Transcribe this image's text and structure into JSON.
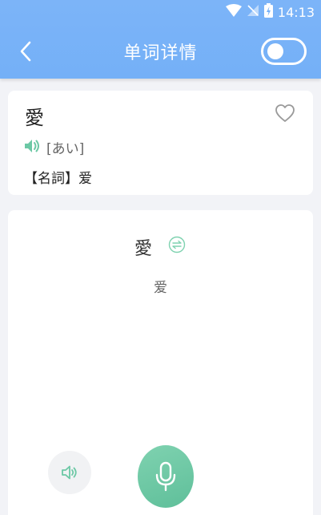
{
  "status_bar": {
    "time": "14:13",
    "icons": [
      "wifi-icon",
      "no-signal-icon",
      "battery-charging-icon"
    ]
  },
  "header": {
    "title": "单词详情",
    "back_icon": "chevron-left-icon",
    "toggle_on": false
  },
  "word_card": {
    "word": "愛",
    "reading": "[あい]",
    "meaning": "【名詞】爱",
    "favorite_icon": "heart-outline-icon",
    "audio_icon": "speaker-icon"
  },
  "practice_card": {
    "word": "愛",
    "kana": "爱",
    "swap_icon": "swap-icon",
    "play_icon": "speaker-icon",
    "mic_icon": "microphone-icon"
  },
  "colors": {
    "header_bg": "#7cb4f8",
    "accent_green": "#6cc8a5",
    "background": "#f2f3f7"
  }
}
